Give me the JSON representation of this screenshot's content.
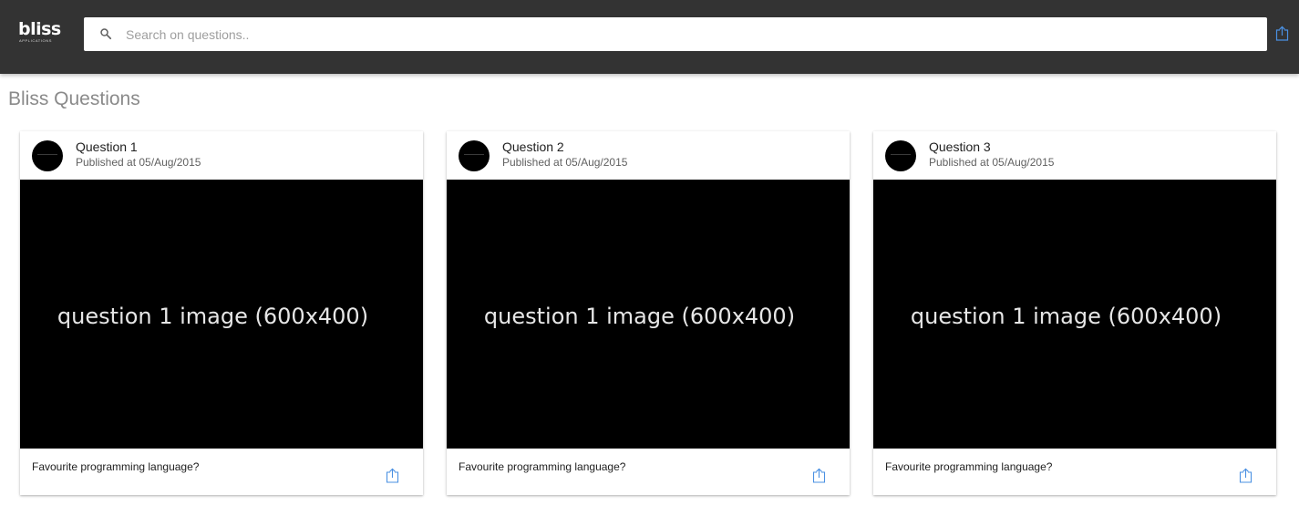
{
  "header": {
    "logo_text": "bliss",
    "logo_subtext": "APPLICATIONS",
    "search": {
      "placeholder": "Search on questions..",
      "icon": "search-icon"
    },
    "share_icon": "share-icon"
  },
  "page": {
    "title": "Bliss Questions"
  },
  "questions": [
    {
      "title": "Question 1",
      "published": "Published at 05/Aug/2015",
      "image_text": "question 1 image (600x400)",
      "text": "Favourite programming language?"
    },
    {
      "title": "Question 2",
      "published": "Published at 05/Aug/2015",
      "image_text": "question 1 image (600x400)",
      "text": "Favourite programming language?"
    },
    {
      "title": "Question 3",
      "published": "Published at 05/Aug/2015",
      "image_text": "question 1 image (600x400)",
      "text": "Favourite programming language?"
    }
  ],
  "colors": {
    "topbar": "#333333",
    "accent": "#4a90e2",
    "title_gray": "#8a8a8a"
  }
}
